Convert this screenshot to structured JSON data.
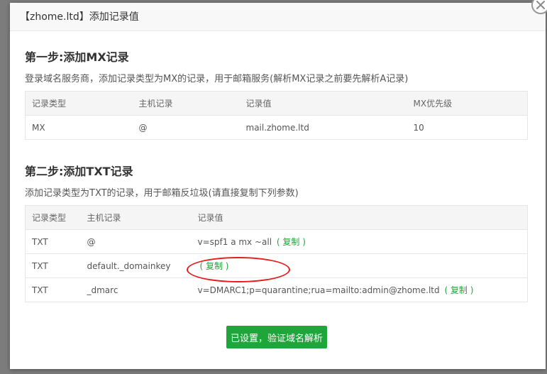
{
  "dialog": {
    "title": "【zhome.ltd】添加记录值",
    "close_icon": "close-icon"
  },
  "step1": {
    "title": "第一步:添加MX记录",
    "description": "登录域名服务商，添加记录类型为MX的记录，用于邮箱服务(解析MX记录之前要先解析A记录)",
    "columns": [
      "记录类型",
      "主机记录",
      "记录值",
      "MX优先级"
    ],
    "rows": [
      {
        "type": "MX",
        "host": "@",
        "value": "mail.zhome.ltd",
        "priority": "10"
      }
    ]
  },
  "step2": {
    "title": "第二步:添加TXT记录",
    "description": "添加记录类型为TXT的记录，用于邮箱反垃圾(请直接复制下列参数)",
    "columns": [
      "记录类型",
      "主机记录",
      "记录值"
    ],
    "copy_label": "( 复制 )",
    "rows": [
      {
        "type": "TXT",
        "host": "@",
        "value": "v=spf1 a mx ~all"
      },
      {
        "type": "TXT",
        "host": "default._domainkey",
        "value": ""
      },
      {
        "type": "TXT",
        "host": "_dmarc",
        "value": "v=DMARC1;p=quarantine;rua=mailto:admin@zhome.ltd"
      }
    ]
  },
  "actions": {
    "verify_label": "已设置，验证域名解析"
  },
  "colors": {
    "accent": "#20a53a",
    "annotation": "#e51c1c"
  }
}
